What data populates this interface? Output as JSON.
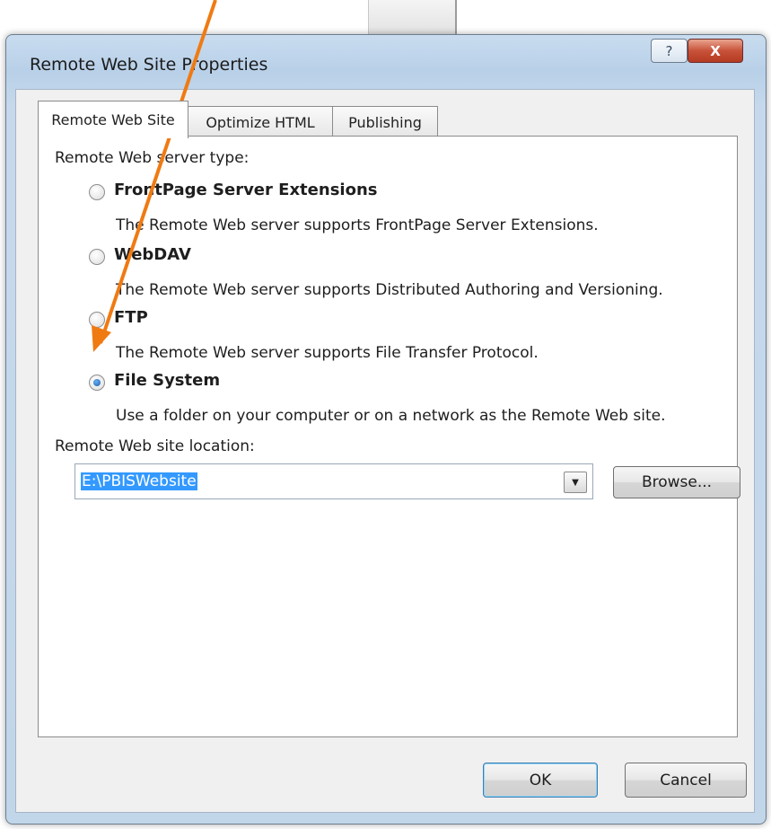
{
  "dialog": {
    "title": "Remote Web Site Properties",
    "help_glyph": "?",
    "close_glyph": "X"
  },
  "tabs": [
    {
      "label": "Remote Web Site",
      "active": true
    },
    {
      "label": "Optimize HTML",
      "active": false
    },
    {
      "label": "Publishing",
      "active": false
    }
  ],
  "server_type_label": "Remote Web server type:",
  "options": [
    {
      "label": "FrontPage Server Extensions",
      "description": "The Remote Web server supports FrontPage Server Extensions.",
      "selected": false
    },
    {
      "label": "WebDAV",
      "description": "The Remote Web server supports Distributed Authoring and Versioning.",
      "selected": false
    },
    {
      "label": "FTP",
      "description": "The Remote Web server supports File Transfer Protocol.",
      "selected": false
    },
    {
      "label": "File System",
      "description": "Use a folder on your computer or on a network as the Remote Web site.",
      "selected": true
    }
  ],
  "location": {
    "label": "Remote Web site location:",
    "value": "E:\\PBISWebsite",
    "dropdown_glyph": "▼",
    "browse_label": "Browse..."
  },
  "buttons": {
    "ok": "OK",
    "cancel": "Cancel"
  },
  "colors": {
    "annotation_arrow": "#f07a12",
    "selection": "#3399ff",
    "close_button": "#c8523a"
  }
}
